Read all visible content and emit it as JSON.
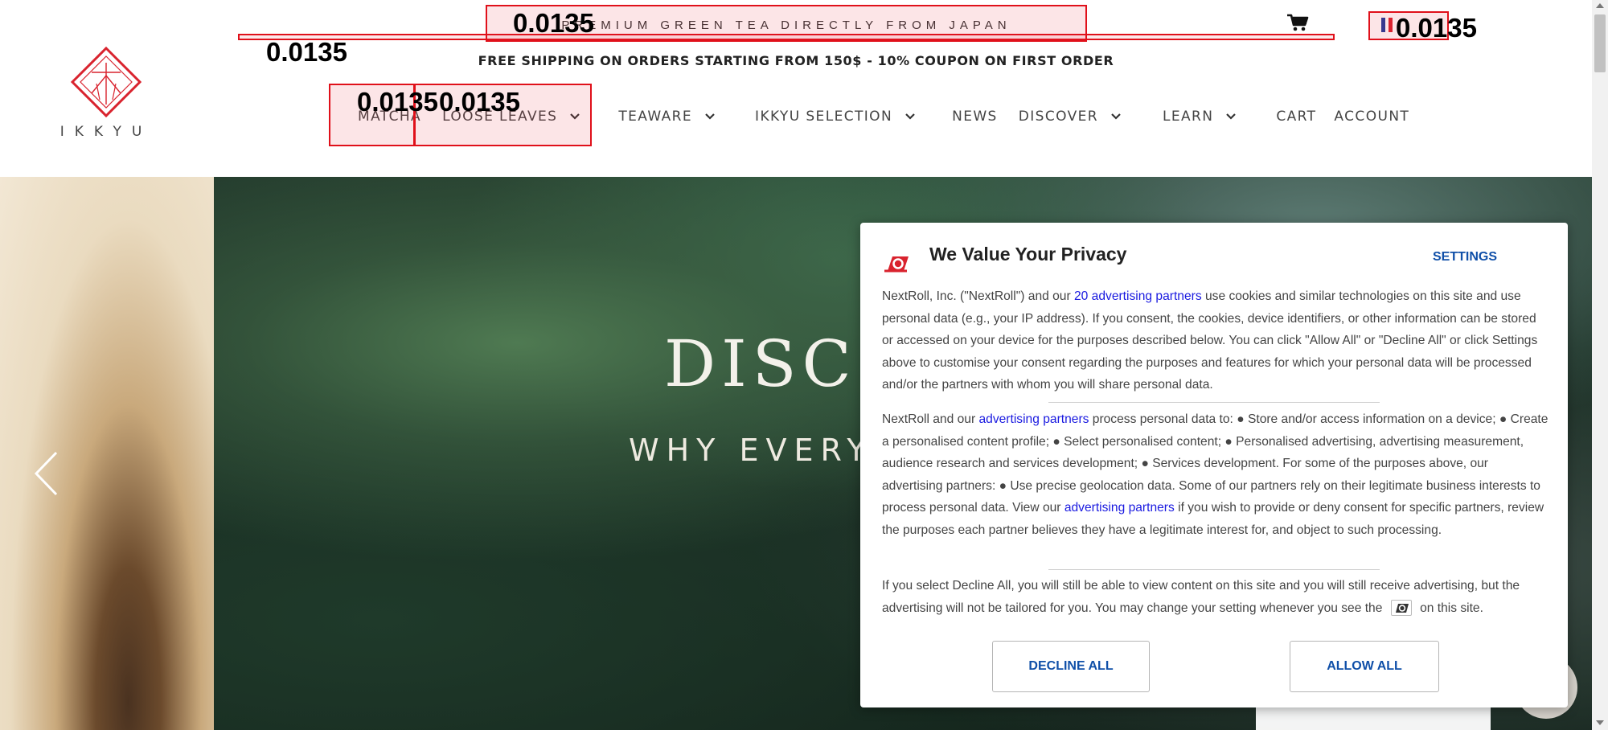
{
  "header": {
    "logo_text": "IKKYU",
    "promo": "PREMIUM GREEN TEA DIRECTLY FROM JAPAN",
    "shipping": "FREE SHIPPING ON ORDERS STARTING FROM 150$ - 10% COUPON ON FIRST ORDER",
    "cart_icon": "cart-icon",
    "language_flag_colors": [
      "#1f3c9b",
      "#ffffff",
      "#d9232e"
    ],
    "nav": [
      {
        "label": "MATCHA",
        "dropdown": false
      },
      {
        "label": "LOOSE LEAVES",
        "dropdown": true
      },
      {
        "label": "TEAWARE",
        "dropdown": true
      },
      {
        "label": "IKKYU SELECTION",
        "dropdown": true
      },
      {
        "label": "NEWS",
        "dropdown": false
      },
      {
        "label": "DISCOVER",
        "dropdown": true
      },
      {
        "label": "LEARN",
        "dropdown": true
      },
      {
        "label": "CART",
        "dropdown": false
      },
      {
        "label": "ACCOUNT",
        "dropdown": false
      }
    ]
  },
  "overlay_labels": [
    "0.0135",
    "0.0135",
    "0.0135",
    "0.0135",
    "0.0135"
  ],
  "hero": {
    "title": "DISCO",
    "subtitle": "WHY EVERY",
    "prev_icon": "chevron-left-icon"
  },
  "consent": {
    "title": "We Value Your Privacy",
    "settings": "SETTINGS",
    "p1_before": "NextRoll, Inc. (\"NextRoll\") and our ",
    "p1_link": "20 advertising partners",
    "p1_after": " use cookies and similar technologies on this site and use personal data (e.g., your IP address). If you consent, the cookies, device identifiers, or other information can be stored or accessed on your device for the purposes described below. You can click \"Allow All\" or \"Decline All\" or click Settings above to customise your consent regarding the purposes and features for which your personal data will be processed and/or the partners with whom you will share personal data.",
    "p2_before": "NextRoll and our ",
    "p2_link1": "advertising partners",
    "p2_mid": " process personal data to: ● Store and/or access information on a device; ● Create a personalised content profile; ● Select personalised content; ● Personalised advertising, advertising measurement, audience research and services development; ● Services development. For some of the purposes above, our advertising partners: ● Use precise geolocation data. Some of our partners rely on their legitimate business interests to process personal data. View our ",
    "p2_link2": "advertising partners",
    "p2_after": " if you wish to provide or deny consent for specific partners, review the purposes each partner believes they have a legitimate interest for, and object to such processing.",
    "p3_before": "If you select Decline All, you will still be able to view content on this site and you will still receive advertising, but the advertising will not be tailored for you. You may change your setting whenever you see the ",
    "p3_after": " on this site.",
    "decline": "DECLINE ALL",
    "allow": "ALLOW ALL",
    "accent_color": "#0f4fa8",
    "logo_color": "#d9232e"
  }
}
